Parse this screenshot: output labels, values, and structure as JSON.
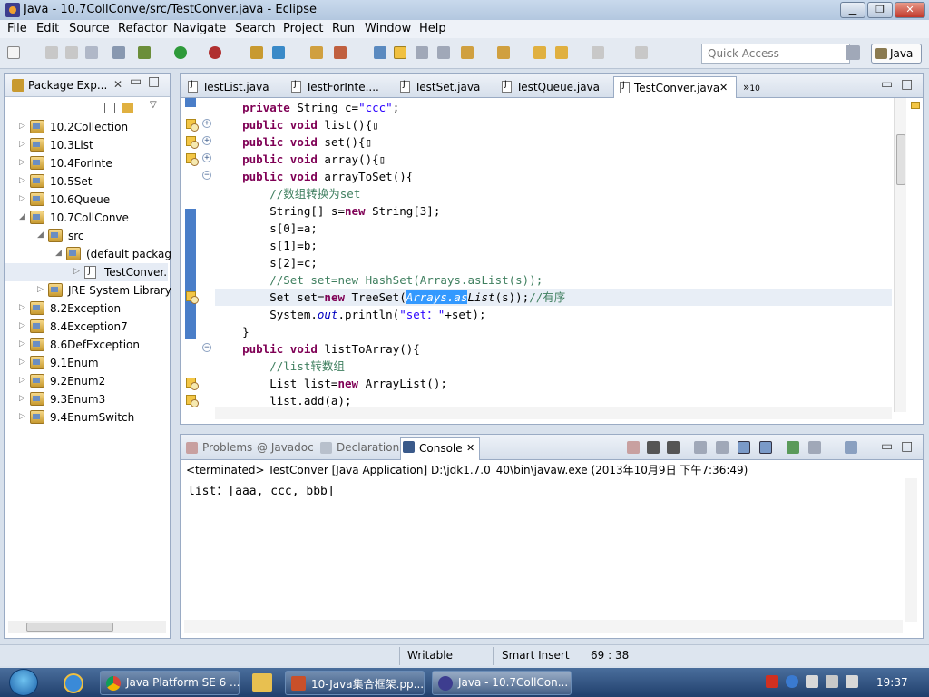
{
  "window": {
    "title": "Java - 10.7CollConve/src/TestConver.java - Eclipse"
  },
  "menu": [
    "File",
    "Edit",
    "Source",
    "Refactor",
    "Navigate",
    "Search",
    "Project",
    "Run",
    "Window",
    "Help"
  ],
  "toolbar": {
    "quick_access_placeholder": "Quick Access",
    "perspective": "Java"
  },
  "package_explorer": {
    "title": "Package Exp...",
    "items": [
      {
        "label": "10.2Collection",
        "level": 0,
        "expanded": false,
        "type": "project"
      },
      {
        "label": "10.3List",
        "level": 0,
        "expanded": false,
        "type": "project"
      },
      {
        "label": "10.4ForInte",
        "level": 0,
        "expanded": false,
        "type": "project"
      },
      {
        "label": "10.5Set",
        "level": 0,
        "expanded": false,
        "type": "project"
      },
      {
        "label": "10.6Queue",
        "level": 0,
        "expanded": false,
        "type": "project"
      },
      {
        "label": "10.7CollConve",
        "level": 0,
        "expanded": true,
        "type": "project"
      },
      {
        "label": "src",
        "level": 1,
        "expanded": true,
        "type": "folder"
      },
      {
        "label": "(default packag",
        "level": 2,
        "expanded": true,
        "type": "package"
      },
      {
        "label": "TestConver.",
        "level": 3,
        "expanded": false,
        "type": "file"
      },
      {
        "label": "JRE System Library",
        "level": 1,
        "expanded": false,
        "type": "library"
      },
      {
        "label": "8.2Exception",
        "level": 0,
        "expanded": false,
        "type": "project"
      },
      {
        "label": "8.4Exception7",
        "level": 0,
        "expanded": false,
        "type": "project"
      },
      {
        "label": "8.6DefException",
        "level": 0,
        "expanded": false,
        "type": "project"
      },
      {
        "label": "9.1Enum",
        "level": 0,
        "expanded": false,
        "type": "project"
      },
      {
        "label": "9.2Enum2",
        "level": 0,
        "expanded": false,
        "type": "project"
      },
      {
        "label": "9.3Enum3",
        "level": 0,
        "expanded": false,
        "type": "project"
      },
      {
        "label": "9.4EnumSwitch",
        "level": 0,
        "expanded": false,
        "type": "project"
      }
    ]
  },
  "editor": {
    "tabs": [
      {
        "label": "TestList.java",
        "active": false
      },
      {
        "label": "TestForInte....",
        "active": false
      },
      {
        "label": "TestSet.java",
        "active": false
      },
      {
        "label": "TestQueue.java",
        "active": false
      },
      {
        "label": "TestConver.java",
        "active": true
      }
    ],
    "overflow_count": "10"
  },
  "console": {
    "tabs": [
      {
        "label": "Problems",
        "active": false
      },
      {
        "label": "@ Javadoc",
        "active": false
      },
      {
        "label": "Declaration",
        "active": false
      },
      {
        "label": "Console",
        "active": true
      }
    ],
    "info": "<terminated> TestConver [Java Application] D:\\jdk1.7.0_40\\bin\\javaw.exe (2013年10月9日 下午7:36:49)",
    "output": "list：[aaa, ccc, bbb]"
  },
  "status": {
    "writable": "Writable",
    "insert_mode": "Smart Insert",
    "position": "69 : 38"
  },
  "taskbar": {
    "items": [
      {
        "label": "Java Platform SE 6 ...",
        "icon": "chrome-icon"
      },
      {
        "label": "10-Java集合框架.pp...",
        "icon": "powerpoint-icon"
      },
      {
        "label": "Java - 10.7CollCon...",
        "icon": "eclipse-icon"
      }
    ],
    "clock": "19:37"
  }
}
